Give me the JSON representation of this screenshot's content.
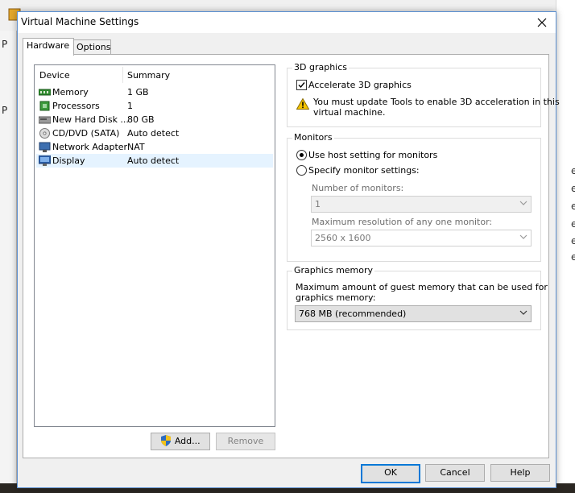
{
  "window": {
    "title": "Virtual Machine Settings"
  },
  "tabs": [
    {
      "label": "Hardware"
    },
    {
      "label": "Options"
    }
  ],
  "device_list": {
    "columns": {
      "device": "Device",
      "summary": "Summary"
    },
    "rows": [
      {
        "name": "Memory",
        "summary": "1 GB",
        "icon": "memory-icon"
      },
      {
        "name": "Processors",
        "summary": "1",
        "icon": "processor-icon"
      },
      {
        "name": "New Hard Disk ...",
        "summary": "80 GB",
        "icon": "hard-disk-icon"
      },
      {
        "name": "CD/DVD (SATA)",
        "summary": "Auto detect",
        "icon": "cd-dvd-icon"
      },
      {
        "name": "Network Adapter",
        "summary": "NAT",
        "icon": "network-adapter-icon"
      },
      {
        "name": "Display",
        "summary": "Auto detect",
        "icon": "display-icon",
        "selected": true
      }
    ]
  },
  "list_buttons": {
    "add": "Add...",
    "remove": "Remove"
  },
  "graphics_3d": {
    "title": "3D graphics",
    "accelerate_label": "Accelerate 3D graphics",
    "accelerate_checked": true,
    "warning_line1": "You must update Tools to enable 3D acceleration in this",
    "warning_line2": "virtual machine."
  },
  "monitors": {
    "title": "Monitors",
    "use_host_label": "Use host setting for monitors",
    "specify_label": "Specify monitor settings:",
    "selected": "use_host",
    "number_label": "Number of monitors:",
    "number_value": "1",
    "max_res_label": "Maximum resolution of any one monitor:",
    "max_res_value": "2560 x 1600"
  },
  "graphics_memory": {
    "title": "Graphics memory",
    "desc_line1": "Maximum amount of guest memory that can be used for",
    "desc_line2": "graphics memory:",
    "value": "768 MB (recommended)"
  },
  "footer": {
    "ok": "OK",
    "cancel": "Cancel",
    "help": "Help"
  },
  "background": {
    "left_fragments": [
      "P",
      "P"
    ],
    "right_fragments": [
      "e",
      "e",
      "e",
      "e",
      "e",
      "e"
    ]
  },
  "colors": {
    "accent": "#0078d7",
    "warning": "#f5c400"
  }
}
